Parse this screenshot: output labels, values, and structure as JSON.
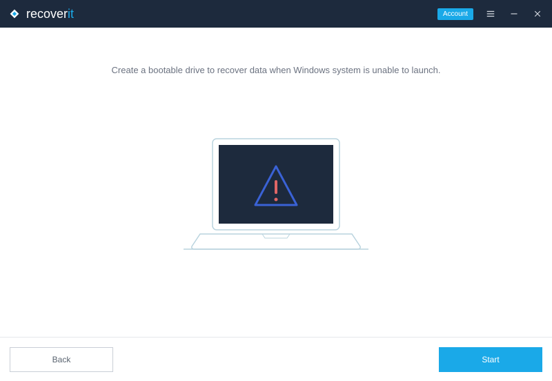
{
  "titlebar": {
    "brand_prefix": "recover",
    "brand_suffix": "it",
    "account_label": "Account"
  },
  "main": {
    "headline": "Create a bootable drive to recover data when Windows system is unable to launch."
  },
  "footer": {
    "back_label": "Back",
    "start_label": "Start"
  },
  "colors": {
    "titlebar_bg": "#1d2a3d",
    "accent": "#1aa9e8",
    "laptop_screen": "#1d2a3d",
    "laptop_outline": "#6fa6c2",
    "triangle": "#3a62d6",
    "exclaim": "#e06666"
  }
}
